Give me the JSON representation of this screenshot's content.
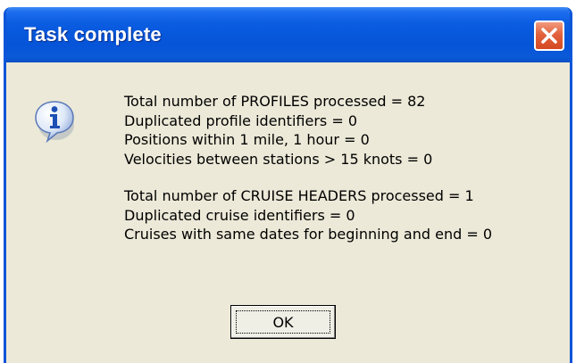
{
  "dialog": {
    "title": "Task complete",
    "close_icon": "close-icon",
    "info_icon": "information-icon",
    "messages_profiles": [
      "Total number of PROFILES processed = 82",
      "Duplicated profile identifiers = 0",
      "Positions within 1 mile, 1 hour = 0",
      "Velocities between stations > 15 knots = 0"
    ],
    "messages_cruises": [
      "Total number of CRUISE HEADERS processed = 1",
      "Duplicated cruise identifiers = 0",
      "Cruises with same dates for beginning and end = 0"
    ],
    "ok_label": "OK"
  },
  "colors": {
    "titlebar": "#0654d8",
    "window_body": "#ece9d8",
    "close_button": "#e2623d"
  }
}
